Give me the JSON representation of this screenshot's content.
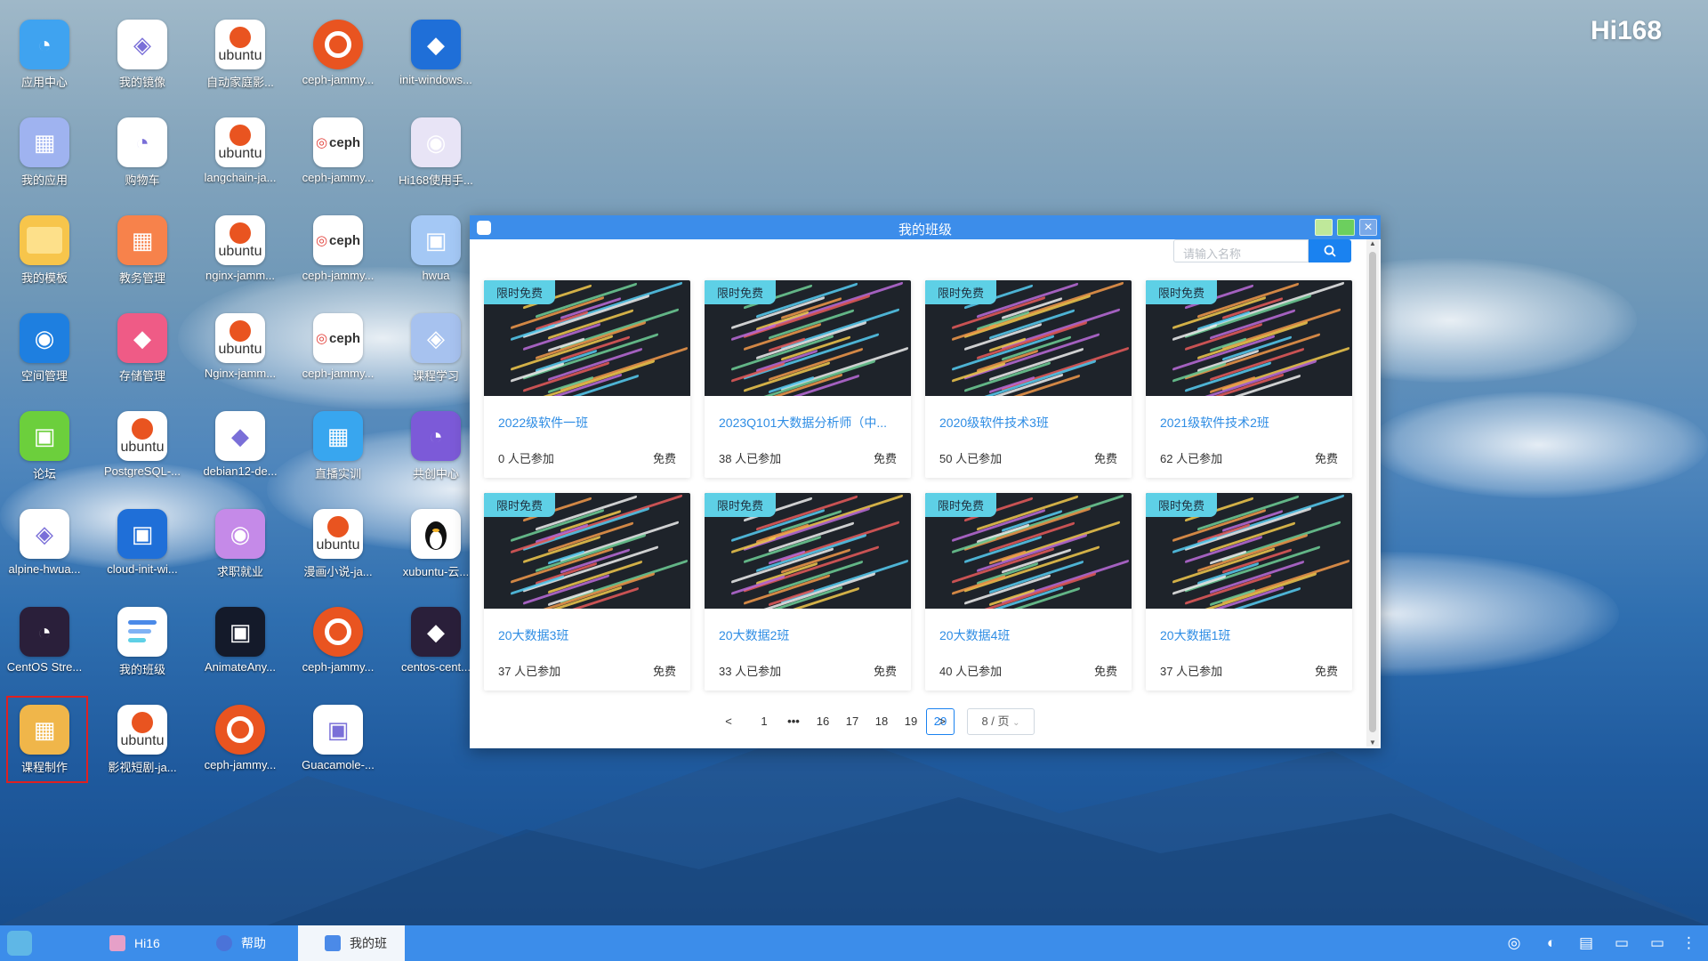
{
  "desktop": {
    "logo": "Hi168",
    "icons": [
      {
        "label": "应用中心",
        "icon": "app-center-icon",
        "color": "#3fa3f0"
      },
      {
        "label": "我的镜像",
        "icon": "my-image-icon",
        "color": "#ffffff"
      },
      {
        "label": "自动家庭影...",
        "icon": "ubuntu-icon",
        "color": "#ffffff"
      },
      {
        "label": "ceph-jammy...",
        "icon": "ubuntu-icon",
        "color": "#e95420"
      },
      {
        "label": "init-windows...",
        "icon": "windows-icon",
        "color": "#1f6fd8"
      },
      {
        "label": "我的应用",
        "icon": "my-apps-icon",
        "color": "#9fb3f0"
      },
      {
        "label": "购物车",
        "icon": "cart-icon",
        "color": "#ffffff"
      },
      {
        "label": "langchain-ja...",
        "icon": "ubuntu-icon",
        "color": "#ffffff"
      },
      {
        "label": "ceph-jammy...",
        "icon": "ceph-icon",
        "color": "#ffffff"
      },
      {
        "label": "Hi168使用手...",
        "icon": "manual-icon",
        "color": "#e8e4f6"
      },
      {
        "label": "我的模板",
        "icon": "folder-icon",
        "color": "#f7c54b"
      },
      {
        "label": "教务管理",
        "icon": "academic-icon",
        "color": "#f7824b"
      },
      {
        "label": "nginx-jamm...",
        "icon": "ubuntu-icon",
        "color": "#ffffff"
      },
      {
        "label": "ceph-jammy...",
        "icon": "ceph-icon",
        "color": "#ffffff"
      },
      {
        "label": "hwua",
        "icon": "hwua-icon",
        "color": "#a4c8f5"
      },
      {
        "label": "空间管理",
        "icon": "space-icon",
        "color": "#1e7fe0"
      },
      {
        "label": "存储管理",
        "icon": "storage-icon",
        "color": "#ef5b86"
      },
      {
        "label": "Nginx-jamm...",
        "icon": "ubuntu-icon",
        "color": "#ffffff"
      },
      {
        "label": "ceph-jammy...",
        "icon": "ceph-icon",
        "color": "#ffffff"
      },
      {
        "label": "课程学习",
        "icon": "course-study-icon",
        "color": "#a7c2ef"
      },
      {
        "label": "论坛",
        "icon": "forum-icon",
        "color": "#6ccf3c"
      },
      {
        "label": "PostgreSQL-...",
        "icon": "ubuntu-icon",
        "color": "#ffffff"
      },
      {
        "label": "debian12-de...",
        "icon": "debian-icon",
        "color": "#ffffff"
      },
      {
        "label": "直播实训",
        "icon": "live-icon",
        "color": "#38a6ef"
      },
      {
        "label": "共创中心",
        "icon": "cocreate-icon",
        "color": "#7c5ad8"
      },
      {
        "label": "alpine-hwua...",
        "icon": "alpine-icon",
        "color": "#ffffff"
      },
      {
        "label": "cloud-init-wi...",
        "icon": "windows-icon",
        "color": "#1f6fd8"
      },
      {
        "label": "求职就业",
        "icon": "job-icon",
        "color": "#c58ae8"
      },
      {
        "label": "漫画小说-ja...",
        "icon": "ubuntu-icon",
        "color": "#ffffff"
      },
      {
        "label": "xubuntu-云...",
        "icon": "linux-penguin-icon",
        "color": "#ffffff"
      },
      {
        "label": "CentOS Stre...",
        "icon": "centos-icon",
        "color": "#2a1f3a"
      },
      {
        "label": "我的班级",
        "icon": "my-class-icon",
        "color": "#ffffff"
      },
      {
        "label": "AnimateAny...",
        "icon": "animate-icon",
        "color": "#141a2a"
      },
      {
        "label": "ceph-jammy...",
        "icon": "ubuntu-icon",
        "color": "#e95420"
      },
      {
        "label": "centos-cent...",
        "icon": "centos-icon",
        "color": "#2a1f3a"
      },
      {
        "label": "课程制作",
        "icon": "course-make-icon",
        "color": "#f0b64a"
      },
      {
        "label": "影视短剧-ja...",
        "icon": "ubuntu-icon",
        "color": "#ffffff"
      },
      {
        "label": "ceph-jammy...",
        "icon": "ubuntu-icon",
        "color": "#e95420"
      },
      {
        "label": "Guacamole-...",
        "icon": "guacamole-icon",
        "color": "#ffffff"
      }
    ]
  },
  "window": {
    "title": "我的班级",
    "search_placeholder": "请输入名称",
    "cards": [
      {
        "tag": "限时免费",
        "title": "2022级软件一班",
        "joined": "0 人已参加",
        "price": "免费"
      },
      {
        "tag": "限时免费",
        "title": "2023Q101大数据分析师（中...",
        "joined": "38 人已参加",
        "price": "免费"
      },
      {
        "tag": "限时免费",
        "title": "2020级软件技术3班",
        "joined": "50 人已参加",
        "price": "免费"
      },
      {
        "tag": "限时免费",
        "title": "2021级软件技术2班",
        "joined": "62 人已参加",
        "price": "免费"
      },
      {
        "tag": "限时免费",
        "title": "20大数据3班",
        "joined": "37 人已参加",
        "price": "免费"
      },
      {
        "tag": "限时免费",
        "title": "20大数据2班",
        "joined": "33 人已参加",
        "price": "免费"
      },
      {
        "tag": "限时免费",
        "title": "20大数据4班",
        "joined": "40 人已参加",
        "price": "免费"
      },
      {
        "tag": "限时免费",
        "title": "20大数据1班",
        "joined": "37 人已参加",
        "price": "免费"
      }
    ],
    "pagination": {
      "prev": "<",
      "pages": [
        "1",
        "•••",
        "16",
        "17",
        "18",
        "19",
        "20"
      ],
      "current": "20",
      "next": ">",
      "page_size": "8 / 页"
    }
  },
  "taskbar": {
    "items": [
      {
        "label": "Hi16",
        "icon": "hi16-icon"
      },
      {
        "label": "帮助",
        "icon": "help-icon"
      },
      {
        "label": "我的班",
        "icon": "my-class-icon"
      }
    ]
  },
  "colors": {
    "accent": "#1a82f0",
    "titlebar": "#3c8dea",
    "tag": "#5ed0e6",
    "link": "#2f8de4"
  }
}
